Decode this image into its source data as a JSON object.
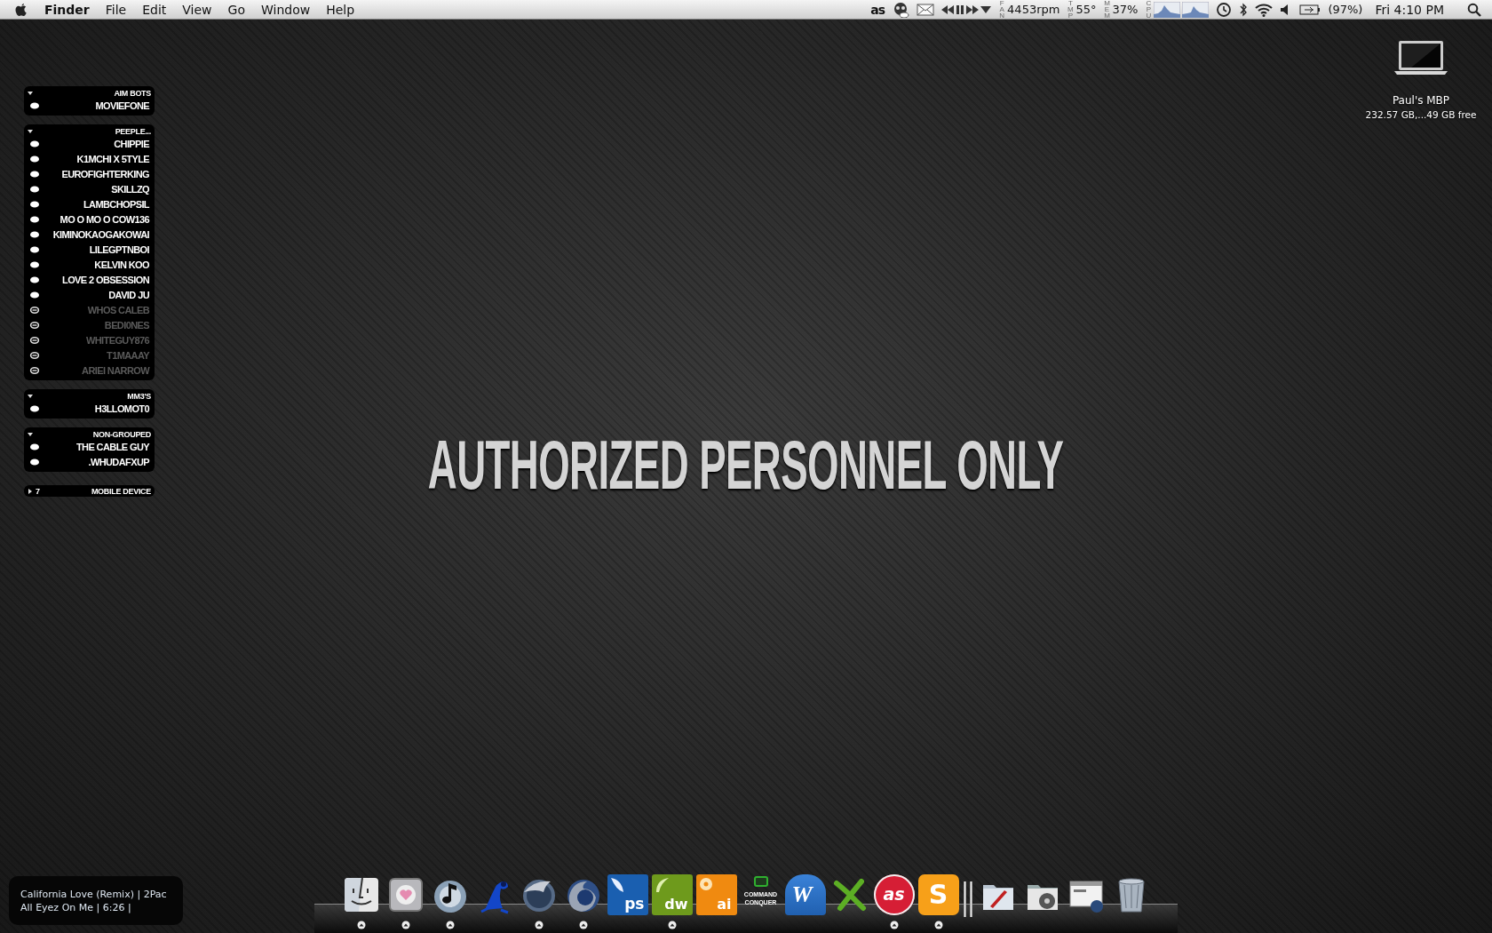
{
  "menu_bar": {
    "app": "Finder",
    "menus": [
      "File",
      "Edit",
      "View",
      "Go",
      "Window",
      "Help"
    ],
    "scrobbler": "as",
    "fan_label": "FAN",
    "fan": "4453rpm",
    "temp_label": "TMP",
    "temp": "55°",
    "mem_label": "MEM",
    "mem": "37%",
    "cpu_label": "CPU",
    "battery": "(97%)",
    "clock": "Fri 4:10 PM"
  },
  "buddy_groups": [
    {
      "name": "AIM BOTS",
      "expanded": true,
      "buddies": [
        {
          "name": "MOVIEFONE",
          "idle": false
        }
      ]
    },
    {
      "name": "PEEPLE...",
      "expanded": true,
      "buddies": [
        {
          "name": "CHIPPIE",
          "idle": false
        },
        {
          "name": "K1MCHI X 5TYLE",
          "idle": false
        },
        {
          "name": "EUROFIGHTERKING",
          "idle": false
        },
        {
          "name": "SKILLZQ",
          "idle": false
        },
        {
          "name": "LAMBCHOPSIL",
          "idle": false
        },
        {
          "name": "MO O MO O COW136",
          "idle": false
        },
        {
          "name": "KIMINOKAOGAKOWAI",
          "idle": false
        },
        {
          "name": "LILEGPTNBOI",
          "idle": false
        },
        {
          "name": "KELVIN KOO",
          "idle": false
        },
        {
          "name": "LOVE 2 OBSESSION",
          "idle": false
        },
        {
          "name": "DAVID JU",
          "idle": false
        },
        {
          "name": "WHOS CALEB",
          "idle": true
        },
        {
          "name": "BEDI0NES",
          "idle": true
        },
        {
          "name": "WHITEGUY876",
          "idle": true
        },
        {
          "name": "T1MAAAY",
          "idle": true
        },
        {
          "name": "ARIEI NARROW",
          "idle": true
        }
      ]
    },
    {
      "name": "MM3'S",
      "expanded": true,
      "buddies": [
        {
          "name": "H3LLOMOT0",
          "idle": false
        }
      ]
    },
    {
      "name": "NON-GROUPED",
      "expanded": true,
      "buddies": [
        {
          "name": "THE CABLE GUY",
          "idle": false
        },
        {
          "name": ".WHUDAFXUP",
          "idle": false
        }
      ]
    },
    {
      "name": "MOBILE DEVICE",
      "expanded": false,
      "count": "7"
    }
  ],
  "drive": {
    "name": "Paul's MBP",
    "detail": "232.57 GB,...49 GB free"
  },
  "headline": "AUTHORIZED PERSONNEL ONLY",
  "now_playing": {
    "line_1": "California Love (Remix) | 2Pac",
    "line_2": "All Eyez On Me | 6:26 |"
  },
  "dock": {
    "items": [
      {
        "running": true
      },
      {
        "running": true
      },
      {
        "running": true
      },
      {
        "running": false
      },
      {
        "running": true
      },
      {
        "running": true
      },
      {
        "running": false,
        "label": "ps"
      },
      {
        "running": true,
        "label": "dw"
      },
      {
        "running": false,
        "label": "ai"
      },
      {
        "running": false,
        "label": "COMMAND CONQUER"
      },
      {
        "running": false,
        "label": "W"
      },
      {
        "running": false
      },
      {
        "running": true,
        "label": "as"
      },
      {
        "running": true,
        "label": "S"
      },
      {
        "running": false
      },
      {
        "running": false
      },
      {
        "running": false
      },
      {
        "running": false
      }
    ]
  }
}
